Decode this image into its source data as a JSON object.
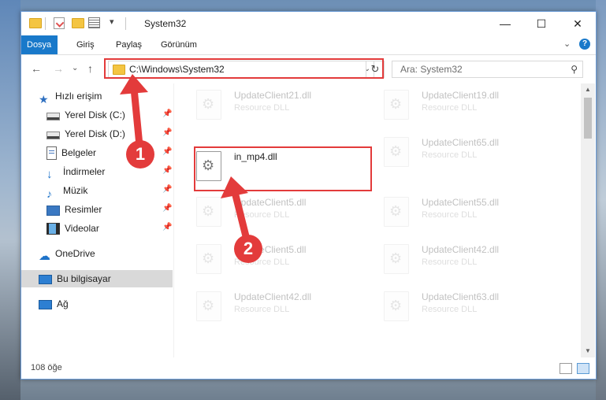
{
  "window": {
    "title": "System32",
    "controls": {
      "minimize": "—",
      "maximize": "☐",
      "close": "✕"
    }
  },
  "ribbon": {
    "tabs": [
      "Dosya",
      "Giriş",
      "Paylaş",
      "Görünüm"
    ],
    "expand_glyph": "⌄",
    "help_glyph": "?"
  },
  "address": {
    "back_glyph": "←",
    "forward_glyph": "→",
    "recent_glyph": "⌄",
    "up_glyph": "↑",
    "path": "C:\\Windows\\System32",
    "dropdown_glyph": "⌄",
    "refresh_glyph": "↻",
    "search_placeholder": "Ara: System32",
    "search_glyph": "⚲"
  },
  "sidebar": {
    "items": [
      {
        "label": "Hızlı erişim",
        "icon": "star-icon",
        "pinned": false
      },
      {
        "label": "Yerel Disk (C:)",
        "icon": "drive-icon",
        "pinned": true
      },
      {
        "label": "Yerel Disk (D:)",
        "icon": "drive-icon",
        "pinned": true
      },
      {
        "label": "Belgeler",
        "icon": "documents-icon",
        "pinned": true
      },
      {
        "label": "İndirmeler",
        "icon": "downloads-icon",
        "pinned": true
      },
      {
        "label": "Müzik",
        "icon": "music-icon",
        "pinned": true
      },
      {
        "label": "Resimler",
        "icon": "pictures-icon",
        "pinned": true
      },
      {
        "label": "Videolar",
        "icon": "videos-icon",
        "pinned": true
      },
      {
        "label": "OneDrive",
        "icon": "cloud-icon",
        "pinned": false
      },
      {
        "label": "Bu bilgisayar",
        "icon": "computer-icon",
        "pinned": false,
        "selected": true
      },
      {
        "label": "Ağ",
        "icon": "network-icon",
        "pinned": false
      }
    ],
    "pin_glyph": "📌"
  },
  "files": [
    {
      "name": "UpdateClient21.dll",
      "type": "Resource DLL",
      "faded": true
    },
    {
      "name": "UpdateClient19.dll",
      "type": "Resource DLL",
      "faded": true
    },
    {
      "name": "in_mp4.dll",
      "type": "",
      "faded": false,
      "highlighted": true
    },
    {
      "name": "UpdateClient65.dll",
      "type": "Resource DLL",
      "faded": true
    },
    {
      "name": "UpdateClient5.dll",
      "type": "Resource DLL",
      "faded": true
    },
    {
      "name": "UpdateClient55.dll",
      "type": "Resource DLL",
      "faded": true
    },
    {
      "name": "UpdateClient5.dll",
      "type": "Resource DLL",
      "faded": true
    },
    {
      "name": "UpdateClient42.dll",
      "type": "Resource DLL",
      "faded": true
    },
    {
      "name": "UpdateClient42.dll",
      "type": "Resource DLL",
      "faded": true
    },
    {
      "name": "UpdateClient63.dll",
      "type": "Resource DLL",
      "faded": true
    }
  ],
  "status": {
    "item_count": "108 öğe"
  },
  "annotations": {
    "step1": "1",
    "step2": "2",
    "color": "#e33b3b"
  }
}
